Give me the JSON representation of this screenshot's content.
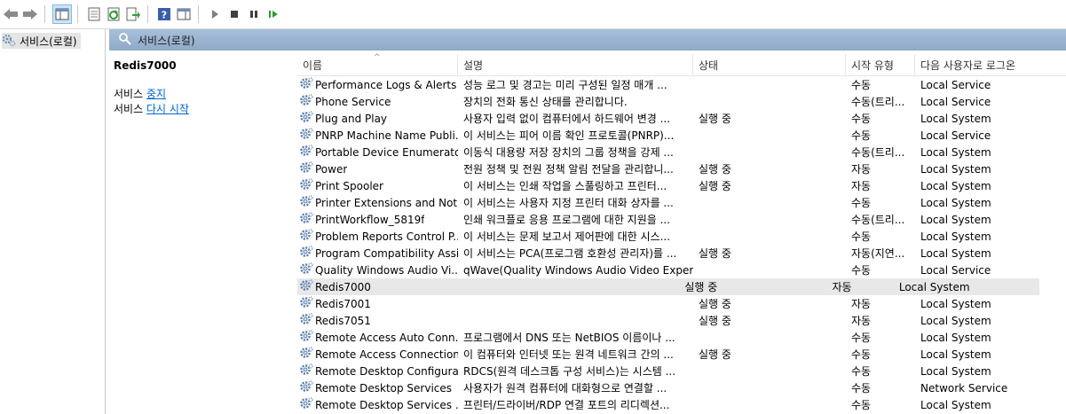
{
  "toolbar": {
    "buttons": [
      "back-icon",
      "forward-icon",
      "show-tree-icon",
      "properties-icon",
      "refresh-icon",
      "export-icon",
      "help-icon",
      "action-pane-icon",
      "start-icon",
      "stop-icon",
      "pause-icon",
      "restart-icon"
    ]
  },
  "tree": {
    "root_label": "서비스(로컬)"
  },
  "panel": {
    "title": "서비스(로컬)"
  },
  "detail": {
    "service_name": "Redis7000",
    "stop_prefix": "서비스 ",
    "stop_link": "중지",
    "restart_prefix": "서비스 ",
    "restart_link": "다시 시작"
  },
  "columns": {
    "name": "이름",
    "desc": "설명",
    "status": "상태",
    "startup": "시작 유형",
    "logon": "다음 사용자로 로그온"
  },
  "rows": [
    {
      "name": "Performance Logs & Alerts",
      "desc": "성능 로그 및 경고는 미리 구성된 일정 매개 ...",
      "status": "",
      "startup": "수동",
      "logon": "Local Service"
    },
    {
      "name": "Phone Service",
      "desc": "장치의 전화 통신 상태를 관리합니다.",
      "status": "",
      "startup": "수동(트리...",
      "logon": "Local Service"
    },
    {
      "name": "Plug and Play",
      "desc": "사용자 입력 없이 컴퓨터에서 하드웨어 변경 ...",
      "status": "실행 중",
      "startup": "수동",
      "logon": "Local System"
    },
    {
      "name": "PNRP Machine Name Publi...",
      "desc": "이 서비스는 피어 이름 확인 프로토콜(PNRP)...",
      "status": "",
      "startup": "수동",
      "logon": "Local Service"
    },
    {
      "name": "Portable Device Enumerato...",
      "desc": "이동식 대용량 저장 장치의 그룹 정책을 강제 ...",
      "status": "",
      "startup": "수동(트리...",
      "logon": "Local System"
    },
    {
      "name": "Power",
      "desc": "전원 정책 및 전원 정책 알림 전달을 관리합니...",
      "status": "실행 중",
      "startup": "자동",
      "logon": "Local System"
    },
    {
      "name": "Print Spooler",
      "desc": "이 서비스는 인쇄 작업을 스풀링하고 프린터...",
      "status": "실행 중",
      "startup": "자동",
      "logon": "Local System"
    },
    {
      "name": "Printer Extensions and Noti...",
      "desc": "이 서비스는 사용자 지정 프린터 대화 상자를 ...",
      "status": "",
      "startup": "수동",
      "logon": "Local System"
    },
    {
      "name": "PrintWorkflow_5819f",
      "desc": "인쇄 워크플로 응용 프로그램에 대한 지원을 ...",
      "status": "",
      "startup": "수동(트리...",
      "logon": "Local System"
    },
    {
      "name": "Problem Reports Control P...",
      "desc": "이 서비스는 문제 보고서 제어판에 대한 시스...",
      "status": "",
      "startup": "수동",
      "logon": "Local System"
    },
    {
      "name": "Program Compatibility Assi...",
      "desc": "이 서비스는 PCA(프로그램 호환성 관리자)를 ...",
      "status": "실행 중",
      "startup": "자동(지연...",
      "logon": "Local System"
    },
    {
      "name": "Quality Windows Audio Vi...",
      "desc": "qWave(Quality Windows Audio Video Experie...",
      "status": "",
      "startup": "수동",
      "logon": "Local Service"
    },
    {
      "name": "Redis7000",
      "desc": "",
      "status": "실행 중",
      "startup": "자동",
      "logon": "Local System",
      "selected": true
    },
    {
      "name": "Redis7001",
      "desc": "",
      "status": "실행 중",
      "startup": "자동",
      "logon": "Local System"
    },
    {
      "name": "Redis7051",
      "desc": "",
      "status": "실행 중",
      "startup": "자동",
      "logon": "Local System"
    },
    {
      "name": "Remote Access Auto Conn...",
      "desc": "프로그램에서 DNS 또는 NetBIOS 이름이나 ...",
      "status": "",
      "startup": "수동",
      "logon": "Local System"
    },
    {
      "name": "Remote Access Connection...",
      "desc": "이 컴퓨터와 인터넷 또는 원격 네트워크 간의 ...",
      "status": "실행 중",
      "startup": "수동",
      "logon": "Local System"
    },
    {
      "name": "Remote Desktop Configura...",
      "desc": "RDCS(원격 데스크톱 구성 서비스)는 시스템 ...",
      "status": "",
      "startup": "수동",
      "logon": "Local System"
    },
    {
      "name": "Remote Desktop Services",
      "desc": "사용자가 원격 컴퓨터에 대화형으로 연결할 ...",
      "status": "",
      "startup": "수동",
      "logon": "Network Service"
    },
    {
      "name": "Remote Desktop Services ...",
      "desc": "프린터/드라이버/RDP 연결 포트의 리디렉션...",
      "status": "",
      "startup": "수동",
      "logon": "Local System"
    }
  ],
  "colors": {
    "panel_header": "#9db5d2",
    "link": "#0066cc",
    "selected_row": "#e8e8e8"
  }
}
